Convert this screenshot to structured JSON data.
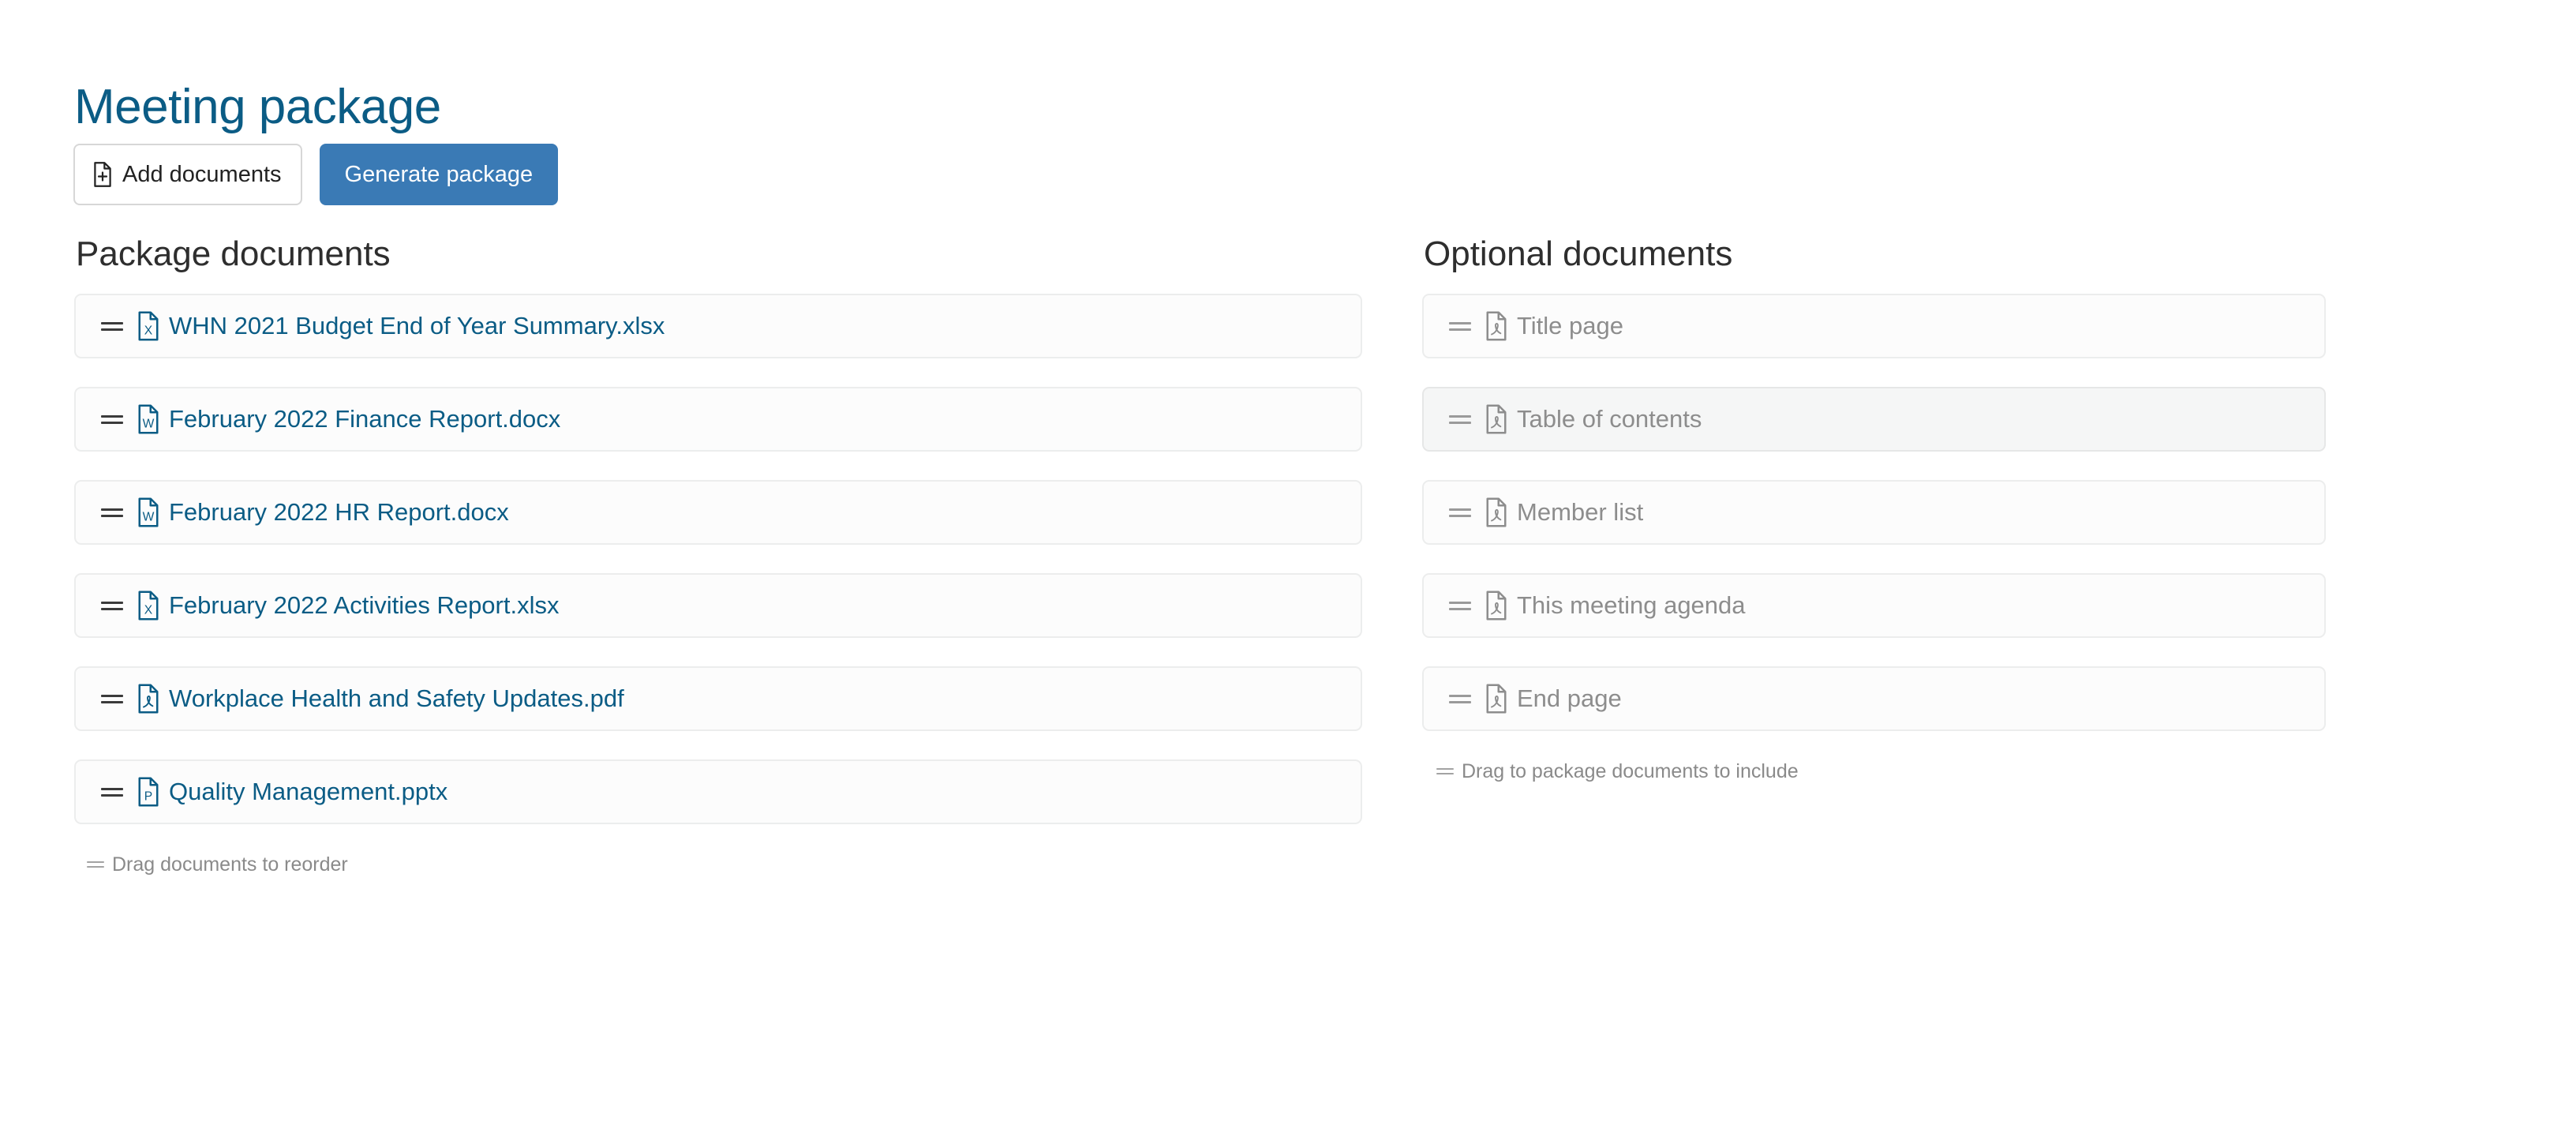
{
  "header": {
    "title": "Meeting package",
    "buttons": [
      {
        "id": "add-documents",
        "label": "Add documents",
        "icon": "file-plus-icon",
        "style": "secondary"
      },
      {
        "id": "generate-package",
        "label": "Generate package",
        "icon": "",
        "style": "primary"
      }
    ]
  },
  "colors": {
    "brand_blue": "#0b5c85",
    "primary_button": "#3a7ab5",
    "row_border": "#eceded",
    "row_background": "#fcfcfc",
    "row_background_hover": "#f5f6f6",
    "muted_text": "#8d8d8d",
    "hint_text": "#8a8a8a",
    "heading_text": "#2e2e2e"
  },
  "package_column": {
    "heading": "Package documents",
    "hint": "Drag documents to reorder",
    "hint_icon": "drag-handle-icon",
    "documents": [
      {
        "name": "WHN 2021 Budget End of Year Summary.xlsx",
        "filetype": "xlsx",
        "icon": "file-excel-icon",
        "icon_letter": "X",
        "hover": false
      },
      {
        "name": "February 2022 Finance Report.docx",
        "filetype": "docx",
        "icon": "file-word-icon",
        "icon_letter": "W",
        "hover": false
      },
      {
        "name": "February 2022 HR Report.docx",
        "filetype": "docx",
        "icon": "file-word-icon",
        "icon_letter": "W",
        "hover": false
      },
      {
        "name": "February 2022 Activities Report.xlsx",
        "filetype": "xlsx",
        "icon": "file-excel-icon",
        "icon_letter": "X",
        "hover": false
      },
      {
        "name": "Workplace Health and Safety Updates.pdf",
        "filetype": "pdf",
        "icon": "file-pdf-icon",
        "icon_letter": "",
        "hover": false
      },
      {
        "name": "Quality Management.pptx",
        "filetype": "pptx",
        "icon": "file-powerpoint-icon",
        "icon_letter": "P",
        "hover": false
      }
    ]
  },
  "optional_column": {
    "heading": "Optional documents",
    "hint": "Drag to package documents to include",
    "hint_icon": "drag-handle-icon",
    "documents": [
      {
        "name": "Title page",
        "filetype": "pdf",
        "icon": "file-pdf-icon",
        "hover": false
      },
      {
        "name": "Table of contents",
        "filetype": "pdf",
        "icon": "file-pdf-icon",
        "hover": true
      },
      {
        "name": "Member list",
        "filetype": "pdf",
        "icon": "file-pdf-icon",
        "hover": false
      },
      {
        "name": "This meeting agenda",
        "filetype": "pdf",
        "icon": "file-pdf-icon",
        "hover": false
      },
      {
        "name": "End page",
        "filetype": "pdf",
        "icon": "file-pdf-icon",
        "hover": false
      }
    ]
  }
}
